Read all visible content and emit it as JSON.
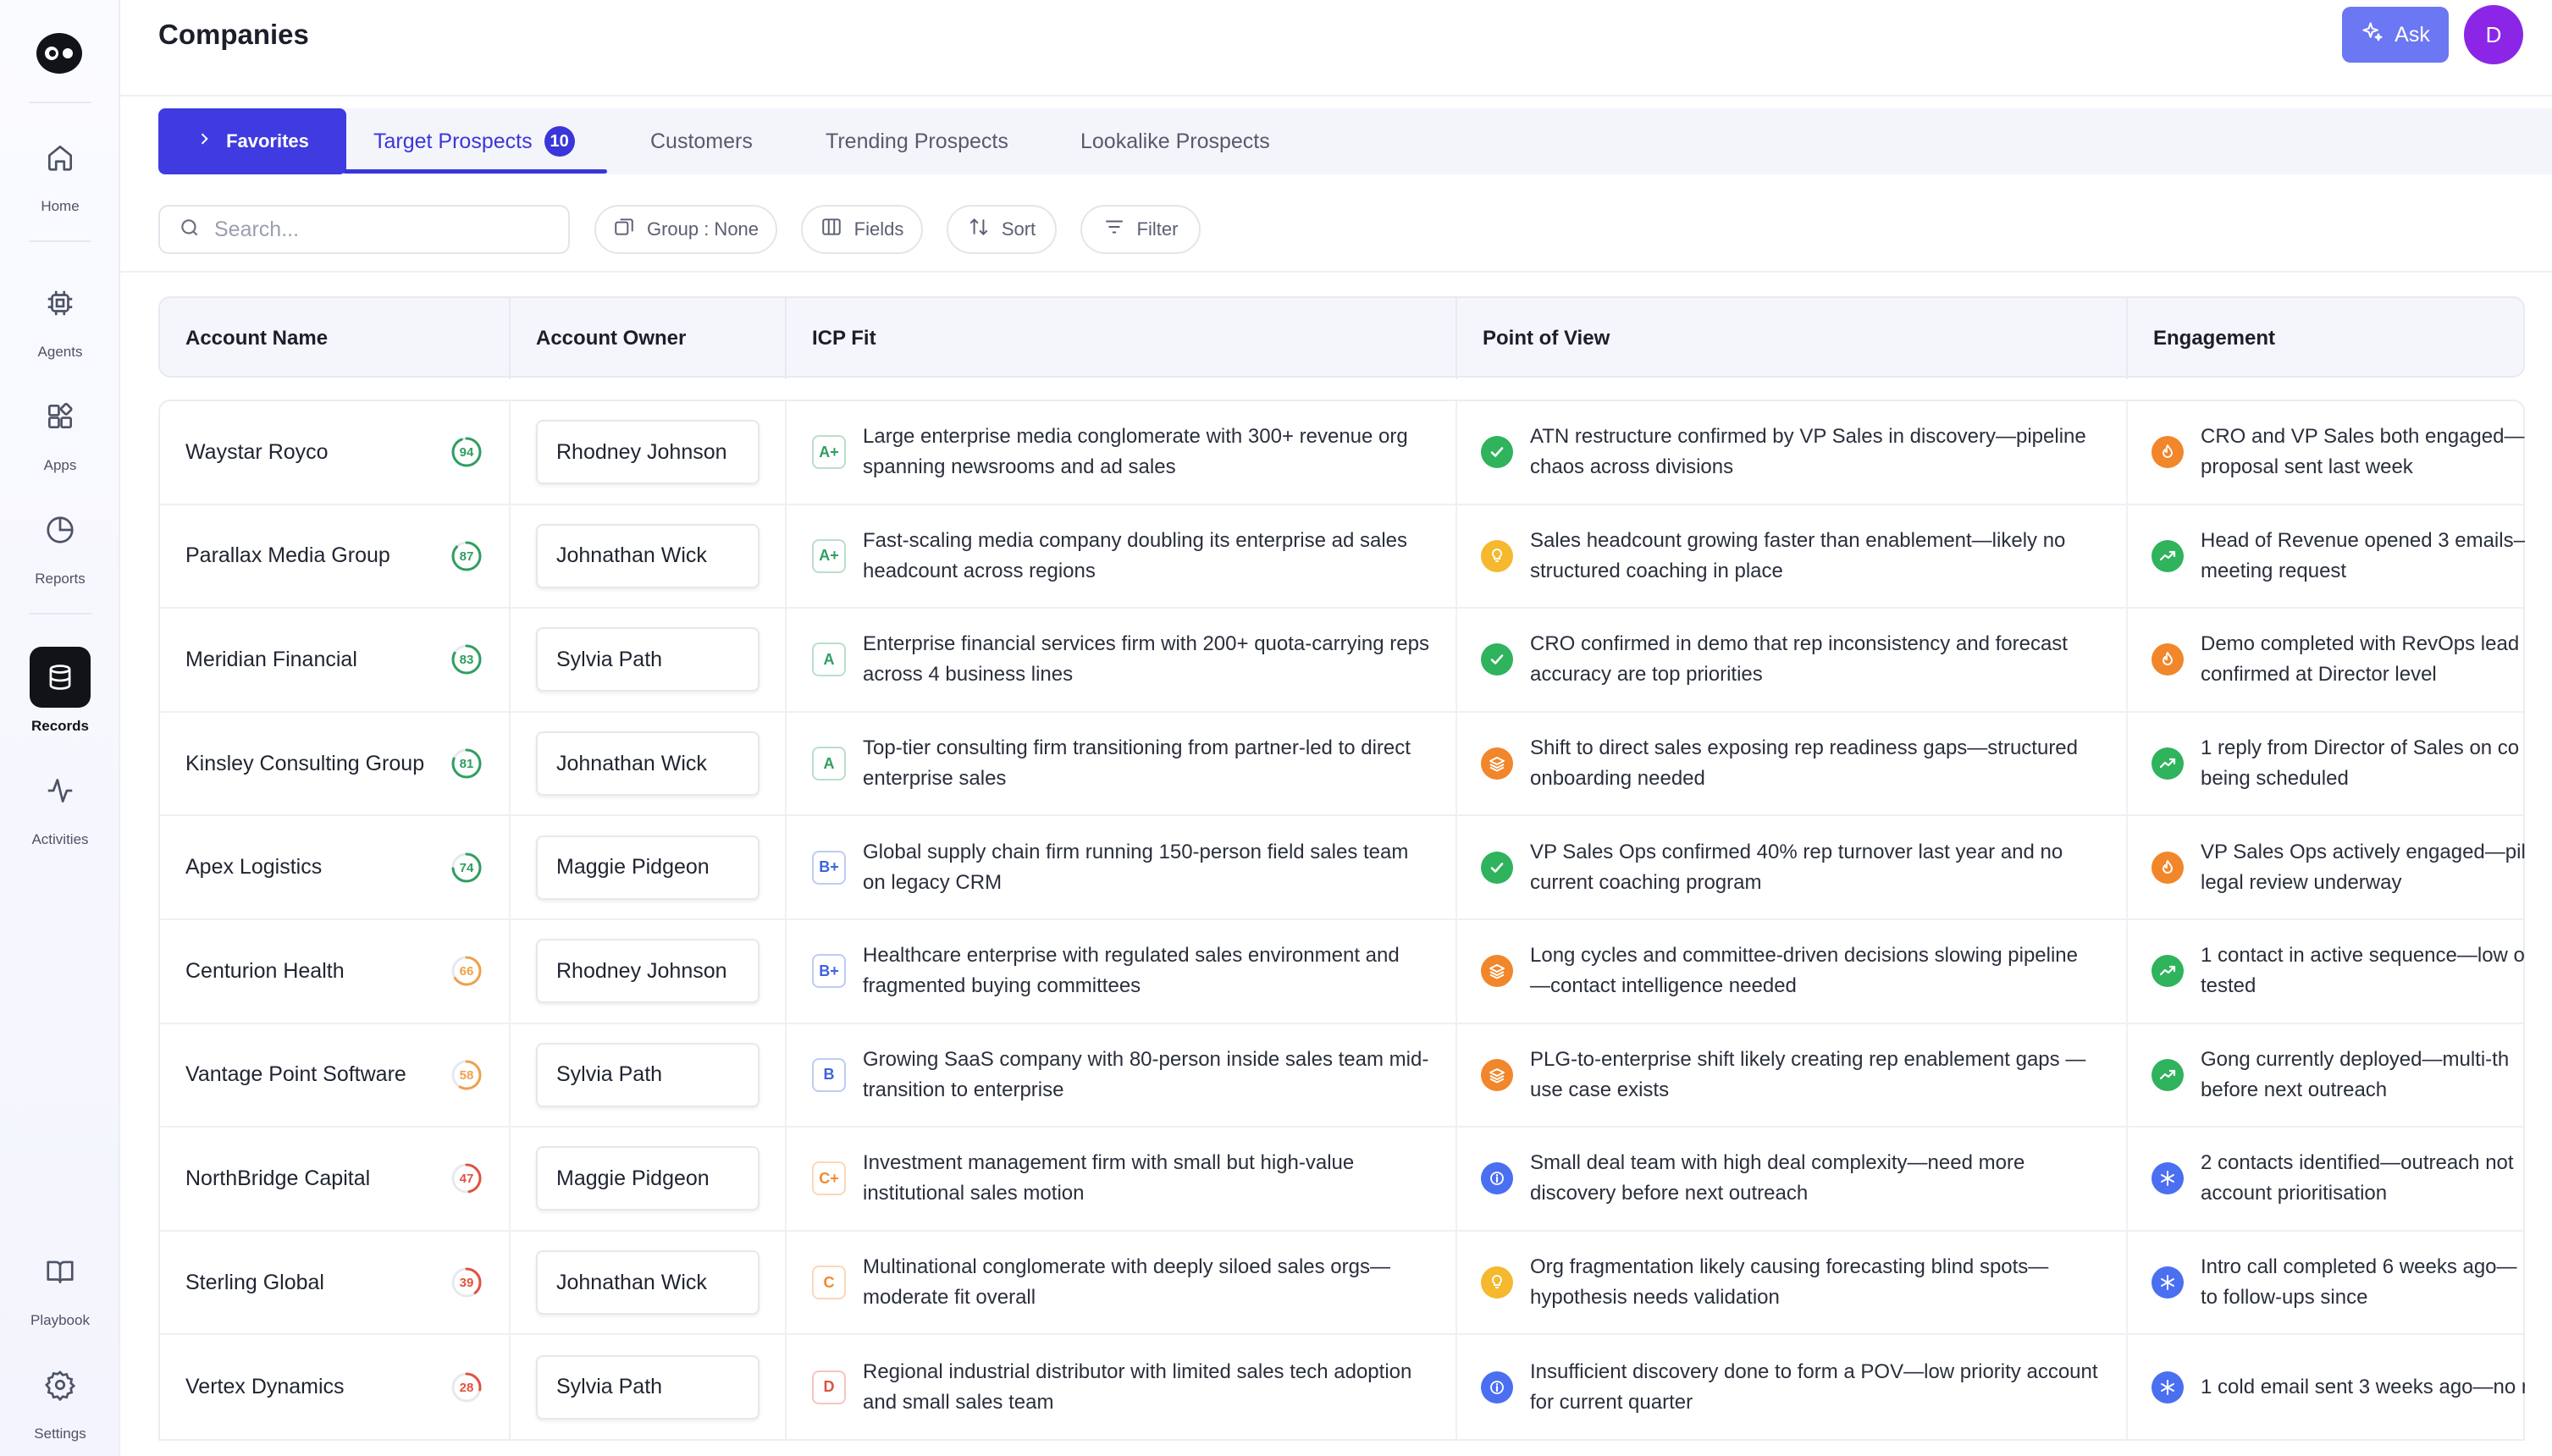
{
  "sidebar": {
    "logo_icon": "eye-logo-icon",
    "items": [
      {
        "label": "Home",
        "icon": "home-icon"
      },
      {
        "label": "Agents",
        "icon": "chip-icon"
      },
      {
        "label": "Apps",
        "icon": "apps-icon"
      },
      {
        "label": "Reports",
        "icon": "pie-chart-icon"
      },
      {
        "label": "Records",
        "icon": "database-icon",
        "active": true
      },
      {
        "label": "Activities",
        "icon": "activity-icon"
      },
      {
        "label": "Playbook",
        "icon": "book-icon"
      },
      {
        "label": "Settings",
        "icon": "gear-icon"
      }
    ]
  },
  "header": {
    "title": "Companies",
    "ask_label": "Ask",
    "avatar_initial": "D"
  },
  "tabs": {
    "favorites_label": "Favorites",
    "items": [
      {
        "label": "Target Prospects",
        "badge": "10",
        "active": true
      },
      {
        "label": "Customers"
      },
      {
        "label": "Trending Prospects"
      },
      {
        "label": "Lookalike Prospects"
      }
    ]
  },
  "toolbar": {
    "search_placeholder": "Search...",
    "group_label": "Group : None",
    "fields_label": "Fields",
    "sort_label": "Sort",
    "filter_label": "Filter"
  },
  "table": {
    "columns": [
      "Account Name",
      "Account Owner",
      "ICP Fit",
      "Point of View",
      "Engagement"
    ],
    "rows": [
      {
        "name": "Waystar Royco",
        "score": "94",
        "score_color": "#2f9e61",
        "owner": "Rhodney Johnson",
        "grade": "A+",
        "grade_color": "#2f9e61",
        "icp": "Large enterprise media conglomerate with 300+ revenue org spanning newsrooms and ad sales",
        "pov_icon": "check",
        "pov": "ATN restructure confirmed by VP Sales in discovery—pipeline chaos across divisions",
        "eng_icon": "flame",
        "eng": "CRO and VP Sales both engaged—",
        "eng2": "proposal sent last week"
      },
      {
        "name": "Parallax Media Group",
        "score": "87",
        "score_color": "#2f9e61",
        "owner": "Johnathan Wick",
        "grade": "A+",
        "grade_color": "#2f9e61",
        "icp": "Fast-scaling media company doubling its enterprise ad sales headcount across regions",
        "pov_icon": "bulb",
        "pov": "Sales headcount growing faster than enablement—likely no structured coaching in place",
        "eng_icon": "trend",
        "eng": "Head of Revenue opened 3 emails—",
        "eng2": "meeting request"
      },
      {
        "name": "Meridian Financial",
        "score": "83",
        "score_color": "#2f9e61",
        "owner": "Sylvia Path",
        "grade": "A",
        "grade_color": "#2f9e61",
        "icp": "Enterprise financial services firm with 200+ quota-carrying reps across 4 business lines",
        "pov_icon": "check",
        "pov": "CRO confirmed in demo that rep inconsistency and forecast accuracy are top priorities",
        "eng_icon": "flame",
        "eng": "Demo completed with RevOps lead",
        "eng2": "confirmed at Director level"
      },
      {
        "name": "Kinsley Consulting Group",
        "score": "81",
        "score_color": "#2f9e61",
        "owner": "Johnathan Wick",
        "grade": "A",
        "grade_color": "#2f9e61",
        "icp": "Top-tier consulting firm transitioning from partner-led to direct enterprise sales",
        "pov_icon": "layers",
        "pov": "Shift to direct sales exposing rep readiness gaps—structured onboarding needed",
        "eng_icon": "trend",
        "eng": "1 reply from Director of Sales on co",
        "eng2": "being scheduled"
      },
      {
        "name": "Apex Logistics",
        "score": "74",
        "score_color": "#2f9e61",
        "owner": "Maggie Pidgeon",
        "grade": "B+",
        "grade_color": "#3d63dd",
        "icp": "Global supply chain firm running 150-person field sales team on legacy CRM",
        "pov_icon": "check",
        "pov": "VP Sales Ops confirmed 40% rep turnover last year and no current coaching program",
        "eng_icon": "flame",
        "eng": "VP Sales Ops actively engaged—pil",
        "eng2": "legal review underway"
      },
      {
        "name": "Centurion Health",
        "score": "66",
        "score_color": "#f0a04b",
        "owner": "Rhodney Johnson",
        "grade": "B+",
        "grade_color": "#3d63dd",
        "icp": "Healthcare enterprise with regulated sales environment and fragmented buying committees",
        "pov_icon": "layers",
        "pov": "Long cycles and committee-driven decisions slowing pipeline —contact intelligence needed",
        "eng_icon": "trend",
        "eng": "1 contact in active sequence—low o",
        "eng2": "tested"
      },
      {
        "name": "Vantage Point Software",
        "score": "58",
        "score_color": "#f0a04b",
        "owner": "Sylvia Path",
        "grade": "B",
        "grade_color": "#3d63dd",
        "icp": "Growing SaaS company with 80-person inside sales team mid-transition to enterprise",
        "pov_icon": "layers",
        "pov": "PLG-to-enterprise shift likely creating rep enablement gaps —use case exists",
        "eng_icon": "trend",
        "eng": "Gong currently deployed—multi-th",
        "eng2": "before next outreach"
      },
      {
        "name": "NorthBridge Capital",
        "score": "47",
        "score_color": "#e0533f",
        "owner": "Maggie Pidgeon",
        "grade": "C+",
        "grade_color": "#f08a2c",
        "icp": "Investment management firm with small but high-value institutional sales motion",
        "pov_icon": "info",
        "pov": "Small deal team with high deal complexity—need more discovery before next outreach",
        "eng_icon": "snow",
        "eng": "2 contacts identified—outreach not",
        "eng2": "account prioritisation"
      },
      {
        "name": "Sterling Global",
        "score": "39",
        "score_color": "#e0533f",
        "owner": "Johnathan Wick",
        "grade": "C",
        "grade_color": "#f08a2c",
        "icp": "Multinational conglomerate with deeply siloed sales orgs— moderate fit overall",
        "pov_icon": "bulb",
        "pov": "Org fragmentation likely causing forecasting blind spots— hypothesis needs validation",
        "eng_icon": "snow",
        "eng": "Intro call completed 6 weeks ago—",
        "eng2": "to follow-ups since"
      },
      {
        "name": "Vertex Dynamics",
        "score": "28",
        "score_color": "#e0533f",
        "owner": "Sylvia Path",
        "grade": "D",
        "grade_color": "#e0533f",
        "icp": "Regional industrial distributor with limited sales tech adoption and small sales team",
        "pov_icon": "info",
        "pov": "Insufficient discovery done to form a POV—low priority account for current quarter",
        "eng_icon": "snow",
        "eng": "1 cold email sent 3 weeks ago—no r",
        "eng2": ""
      }
    ]
  }
}
